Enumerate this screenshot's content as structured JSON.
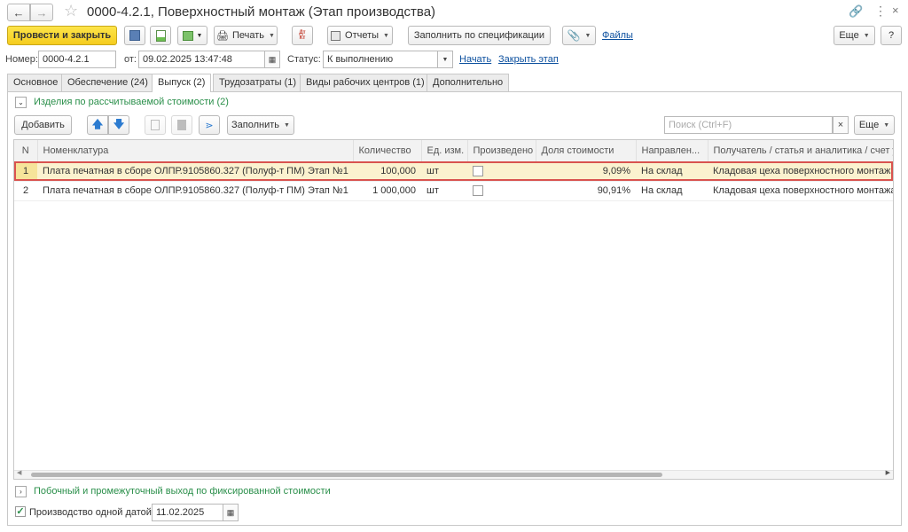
{
  "window": {
    "title": "0000-4.2.1, Поверхностный монтаж (Этап производства)"
  },
  "toolbar": {
    "post_close_label": "Провести и закрыть",
    "print_label": "Печать",
    "dtkt_label": "Дт Кт",
    "reports_label": "Отчеты",
    "fill_spec_label": "Заполнить по спецификации",
    "files_label": "Файлы",
    "more_label": "Еще",
    "help_label": "?"
  },
  "header": {
    "number_label": "Номер:",
    "number_value": "0000-4.2.1",
    "date_label": "от:",
    "date_value": "09.02.2025 13:47:48",
    "status_label": "Статус:",
    "status_value": "К выполнению",
    "start_link": "Начать",
    "close_link": "Закрыть этап"
  },
  "tabs": [
    {
      "label": "Основное"
    },
    {
      "label": "Обеспечение (24)"
    },
    {
      "label": "Выпуск (2)"
    },
    {
      "label": "Трудозатраты (1)"
    },
    {
      "label": "Виды рабочих центров (1)"
    },
    {
      "label": "Дополнительно"
    }
  ],
  "section1": {
    "title": "Изделия по рассчитываемой стоимости (2)",
    "add_label": "Добавить",
    "fill_label": "Заполнить",
    "search_placeholder": "Поиск (Ctrl+F)",
    "more_label": "Еще"
  },
  "table": {
    "columns": [
      "N",
      "Номенклатура",
      "Количество",
      "Ед. изм.",
      "Произведено",
      "Доля стоимости",
      "Направлен...",
      "Получатель / статья и аналитика / счет уч"
    ],
    "rows": [
      {
        "n": "1",
        "item": "Плата печатная в сборе ОЛПР.9105860.327 (Полуф-т ПМ) Этап №1",
        "qty": "100,000",
        "unit": "шт",
        "share": "9,09%",
        "direction": "На склад",
        "receiver": "Кладовая цеха поверхностного монтажа"
      },
      {
        "n": "2",
        "item": "Плата печатная в сборе ОЛПР.9105860.327 (Полуф-т ПМ) Этап №1",
        "qty": "1 000,000",
        "unit": "шт",
        "share": "90,91%",
        "direction": "На склад",
        "receiver": "Кладовая цеха поверхностного монтажа"
      }
    ]
  },
  "section2": {
    "title": "Побочный и промежуточный выход по фиксированной стоимости"
  },
  "footer": {
    "single_date_label": "Производство одной датой",
    "single_date_value": "11.02.2025"
  },
  "colors": {
    "accent_yellow": "#f5cc1e",
    "section_green": "#2a8f4a",
    "selection_border": "#d9534f",
    "selection_bg": "#fbf2cf"
  }
}
